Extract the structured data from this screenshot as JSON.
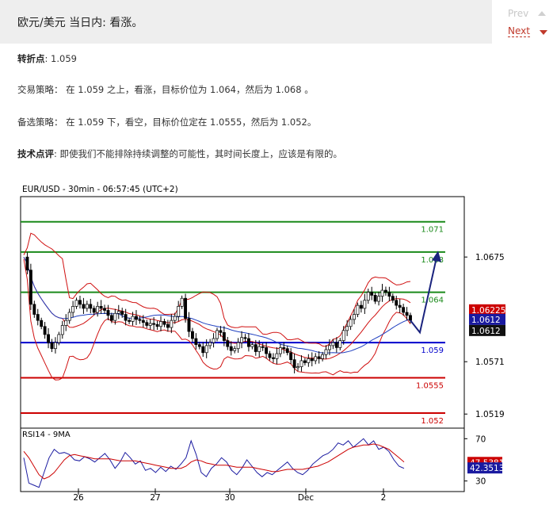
{
  "header": {
    "title": "欧元/美元 当日内: 看涨。",
    "prev_label": "Prev",
    "next_label": "Next"
  },
  "article": {
    "pivot_label": "转折点",
    "pivot_value": ": 1.059",
    "strategy_label": "交易策略",
    "strategy_text": "：  在 1.059 之上，看涨，目标价位为 1.064，然后为 1.068 。",
    "alt_label": "备选策略",
    "alt_text": "：  在 1.059 下，看空，目标价位定在 1.0555，然后为 1.052。",
    "comment_label": "技术点评",
    "comment_text": ": 即使我们不能排除持续调整的可能性，其时间长度上，应该是有限的。"
  },
  "colors": {
    "green": "#1a8a1a",
    "red": "#cc0000",
    "blue": "#0000cc",
    "navy": "#1a237e",
    "bb": "#d01010",
    "ma": "#2040c0"
  },
  "chart_data": [
    {
      "type": "candlestick",
      "title": "EUR/USD - 30min - 06:57:45 (UTC+2)",
      "x_tick_labels": [
        "26",
        "27",
        "30",
        "Dec",
        "2"
      ],
      "y_ticks": [
        1.0675,
        1.0571,
        1.0519
      ],
      "y_tick_labels": [
        "1.0675",
        "1.0571",
        "1.0519"
      ],
      "ylim": [
        1.0505,
        1.0735
      ],
      "levels": [
        {
          "value": 1.071,
          "label": "1.071",
          "color": "green"
        },
        {
          "value": 1.068,
          "label": "1.068",
          "color": "green"
        },
        {
          "value": 1.064,
          "label": "1.064",
          "color": "green"
        },
        {
          "value": 1.059,
          "label": "1.059",
          "color": "blue"
        },
        {
          "value": 1.0555,
          "label": "1.0555",
          "color": "red"
        },
        {
          "value": 1.052,
          "label": "1.052",
          "color": "red"
        }
      ],
      "price_tags": [
        {
          "label": "1.06225",
          "value": 1.06225,
          "bg": "#cc0000",
          "fg": "#ffffff"
        },
        {
          "label": "1.0612",
          "value": 1.0613,
          "bg": "#1a1aa0",
          "fg": "#ffffff"
        },
        {
          "label": "1.0612",
          "value": 1.0602,
          "bg": "#111111",
          "fg": "#ffffff"
        }
      ],
      "projection": [
        [
          1.0612,
          1.06
        ],
        [
          1.0604,
          1.0678
        ]
      ],
      "close_path": [
        1.0675,
        1.0662,
        1.0628,
        1.0618,
        1.0612,
        1.0606,
        1.0598,
        1.059,
        1.0584,
        1.059,
        1.0598,
        1.0607,
        1.0612,
        1.062,
        1.0626,
        1.0632,
        1.0628,
        1.0624,
        1.0628,
        1.0624,
        1.062,
        1.0626,
        1.0624,
        1.0622,
        1.0617,
        1.0612,
        1.0619,
        1.0621,
        1.0618,
        1.0612,
        1.0611,
        1.0616,
        1.0613,
        1.0612,
        1.061,
        1.0607,
        1.0609,
        1.0608,
        1.0606,
        1.0611,
        1.0608,
        1.0605,
        1.0612,
        1.0616,
        1.0626,
        1.0634,
        1.0614,
        1.0601,
        1.0594,
        1.0588,
        1.0586,
        1.058,
        1.0587,
        1.059,
        1.0594,
        1.0602,
        1.06,
        1.0592,
        1.0586,
        1.0582,
        1.0584,
        1.059,
        1.0595,
        1.0594,
        1.0586,
        1.0588,
        1.0581,
        1.0586,
        1.0585,
        1.0579,
        1.0575,
        1.0574,
        1.0579,
        1.0585,
        1.0584,
        1.058,
        1.0573,
        1.0565,
        1.0566,
        1.0572,
        1.057,
        1.0574,
        1.0572,
        1.0576,
        1.0574,
        1.0578,
        1.0583,
        1.0587,
        1.059,
        1.0585,
        1.0592,
        1.0602,
        1.0606,
        1.0613,
        1.0618,
        1.0627,
        1.0624,
        1.0632,
        1.064,
        1.0637,
        1.0631,
        1.0636,
        1.0642,
        1.064,
        1.0636,
        1.0632,
        1.0627,
        1.0625,
        1.062,
        1.0617,
        1.0612
      ]
    },
    {
      "type": "line",
      "title": "RSI14 - 9MA",
      "y_ticks": [
        70,
        30
      ],
      "y_tick_labels": [
        "70",
        "30"
      ],
      "ylim": [
        20,
        80
      ],
      "series": [
        {
          "name": "RSI14",
          "color": "#1a1aa0",
          "values": [
            52,
            28,
            26,
            24,
            38,
            52,
            60,
            56,
            57,
            55,
            50,
            49,
            53,
            51,
            48,
            52,
            56,
            50,
            42,
            48,
            57,
            52,
            46,
            49,
            40,
            42,
            38,
            43,
            39,
            44,
            41,
            46,
            52,
            68,
            55,
            38,
            34,
            42,
            46,
            52,
            48,
            40,
            36,
            42,
            50,
            44,
            38,
            34,
            38,
            36,
            40,
            44,
            48,
            42,
            38,
            36,
            40,
            46,
            50,
            54,
            56,
            60,
            66,
            64,
            68,
            62,
            66,
            70,
            64,
            68,
            60,
            62,
            58,
            50,
            44,
            42
          ]
        },
        {
          "name": "9MA",
          "color": "#cc0000",
          "values": [
            58,
            52,
            44,
            36,
            32,
            34,
            38,
            44,
            50,
            54,
            55,
            54,
            53,
            52,
            51,
            51,
            51,
            51,
            50,
            49,
            49,
            49,
            49,
            48,
            47,
            46,
            45,
            44,
            43,
            42,
            42,
            42,
            44,
            48,
            50,
            49,
            47,
            46,
            45,
            45,
            45,
            44,
            43,
            43,
            43,
            43,
            42,
            41,
            40,
            39,
            39,
            40,
            41,
            41,
            41,
            41,
            42,
            43,
            44,
            46,
            48,
            51,
            54,
            57,
            60,
            62,
            63,
            64,
            64,
            65,
            64,
            62,
            60,
            56,
            52,
            48
          ]
        }
      ],
      "value_tags": [
        {
          "label": "47.5381",
          "value": 47.5381,
          "bg": "#cc0000",
          "fg": "#ffffff"
        },
        {
          "label": "42.3513",
          "value": 42.3513,
          "bg": "#1a1aa0",
          "fg": "#ffffff"
        }
      ]
    }
  ]
}
